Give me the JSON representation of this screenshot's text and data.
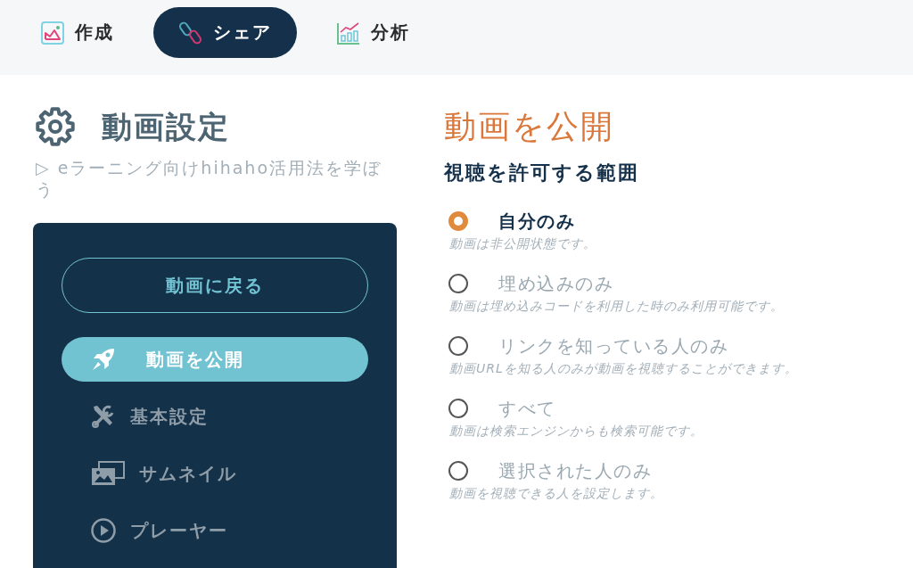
{
  "tabs": [
    {
      "label": "作成",
      "selected": false
    },
    {
      "label": "シェア",
      "selected": true
    },
    {
      "label": "分析",
      "selected": false
    }
  ],
  "settings": {
    "title": "動画設定",
    "link": "▷ eラーニング向けhihaho活用法を学ぼう",
    "back_button": "動画に戻る",
    "menu": [
      {
        "label": "動画を公開",
        "selected": true
      },
      {
        "label": "基本設定",
        "selected": false
      },
      {
        "label": "サムネイル",
        "selected": false
      },
      {
        "label": "プレーヤー",
        "selected": false
      }
    ]
  },
  "publish": {
    "title": "動画を公開",
    "subtitle": "視聴を許可する範囲",
    "options": [
      {
        "label": "自分のみ",
        "description": "動画は非公開状態です。",
        "selected": true
      },
      {
        "label": "埋め込みのみ",
        "description": "動画は埋め込みコードを利用した時のみ利用可能です。",
        "selected": false
      },
      {
        "label": "リンクを知っている人のみ",
        "description": "動画URLを知る人のみが動画を視聴することができます。",
        "selected": false
      },
      {
        "label": "すべて",
        "description": "動画は検索エンジンからも検索可能です。",
        "selected": false
      },
      {
        "label": "選択された人のみ",
        "description": "動画を視聴できる人を設定します。",
        "selected": false
      }
    ]
  }
}
